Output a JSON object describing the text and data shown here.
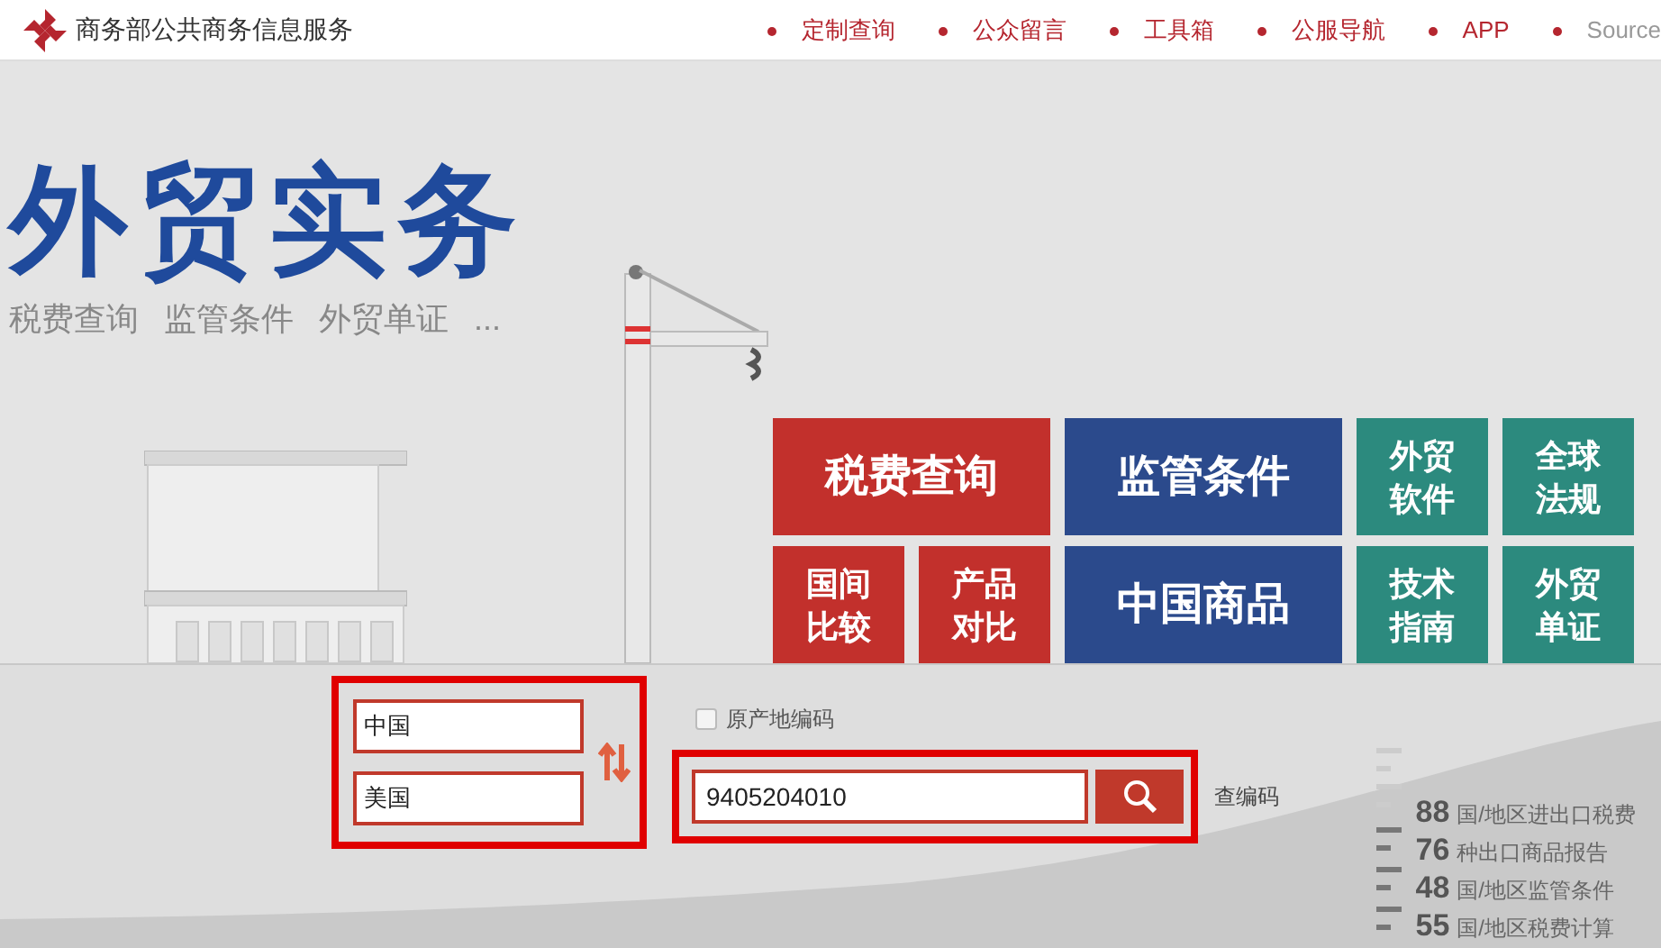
{
  "header": {
    "site_name": "商务部公共商务信息服务",
    "nav": [
      {
        "label": "定制查询"
      },
      {
        "label": "公众留言"
      },
      {
        "label": "工具箱"
      },
      {
        "label": "公服导航"
      },
      {
        "label": "APP"
      }
    ],
    "nav_cut": "Source"
  },
  "hero": {
    "title": "外贸实务",
    "subtitles": [
      "税费查询",
      "监管条件",
      "外贸单证",
      "..."
    ],
    "tiles": [
      {
        "lines": [
          "税费查询"
        ],
        "kind": "wide",
        "color": "#c2302c"
      },
      {
        "lines": [
          "监管条件"
        ],
        "kind": "wide",
        "color": "#2b4a8c"
      },
      {
        "lines": [
          "外贸",
          "软件"
        ],
        "kind": "small",
        "color": "#2c8a7e"
      },
      {
        "lines": [
          "全球",
          "法规"
        ],
        "kind": "small",
        "color": "#2c8a7e"
      },
      {
        "lines": [
          "国间",
          "比较"
        ],
        "kind": "small",
        "color": "#c2302c"
      },
      {
        "lines": [
          "产品",
          "对比"
        ],
        "kind": "small",
        "color": "#c2302c"
      },
      {
        "lines": [
          "中国商品"
        ],
        "kind": "wide",
        "color": "#2b4a8c"
      },
      {
        "lines": [
          "技术",
          "指南"
        ],
        "kind": "small",
        "color": "#2c8a7e"
      },
      {
        "lines": [
          "外贸",
          "单证"
        ],
        "kind": "small",
        "color": "#2c8a7e"
      }
    ]
  },
  "search": {
    "origin": "中国",
    "destination": "美国",
    "origin_code": {
      "label": "原产地编码",
      "checked": false
    },
    "code": "9405204010",
    "lookup_link": "查编码"
  },
  "stats": [
    {
      "number": "88",
      "label": "国/地区进出口税费"
    },
    {
      "number": "76",
      "label": "种出口商品报告"
    },
    {
      "number": "48",
      "label": "国/地区监管条件"
    },
    {
      "number": "55",
      "label": "国/地区税费计算"
    }
  ]
}
